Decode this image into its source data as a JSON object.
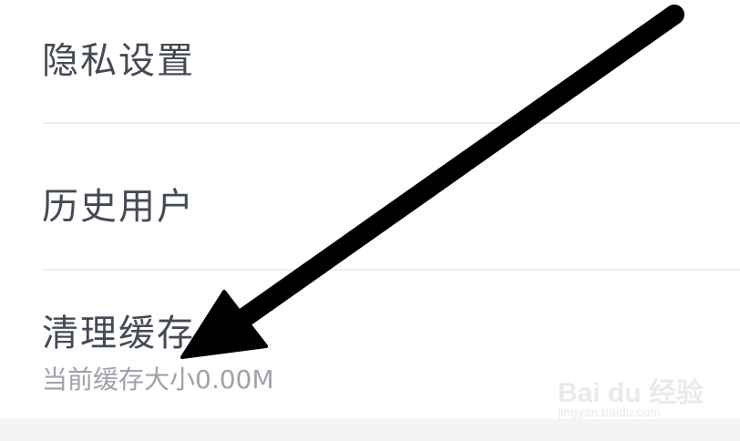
{
  "settings": {
    "privacy_label": "隐私设置",
    "history_label": "历史用户",
    "cache_label": "清理缓存",
    "cache_size_text": "当前缓存大小0.00M"
  },
  "watermark": {
    "brand": "Bai du 经验",
    "url": "jingyan.baidu.com"
  },
  "colors": {
    "label": "#444a55",
    "subtext": "#9ea2a9",
    "divider": "#eceef1",
    "arrow": "#000000"
  },
  "icons": {
    "annotation": "arrow-pointer-icon"
  }
}
